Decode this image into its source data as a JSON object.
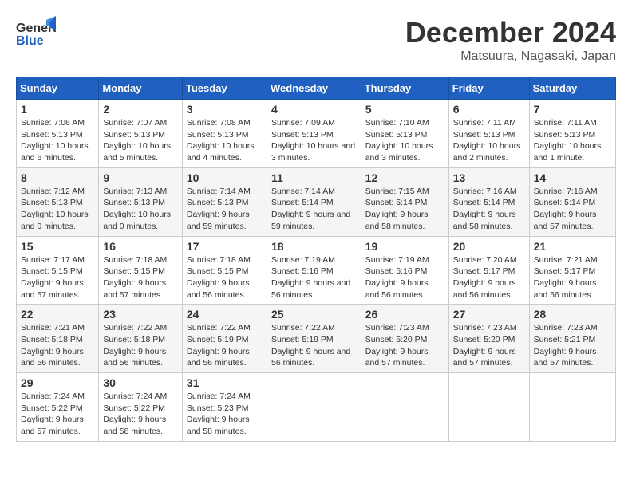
{
  "header": {
    "logo_line1": "General",
    "logo_line2": "Blue",
    "month": "December 2024",
    "location": "Matsuura, Nagasaki, Japan"
  },
  "weekdays": [
    "Sunday",
    "Monday",
    "Tuesday",
    "Wednesday",
    "Thursday",
    "Friday",
    "Saturday"
  ],
  "weeks": [
    [
      {
        "day": 1,
        "sunrise": "7:06 AM",
        "sunset": "5:13 PM",
        "daylight": "10 hours and 6 minutes."
      },
      {
        "day": 2,
        "sunrise": "7:07 AM",
        "sunset": "5:13 PM",
        "daylight": "10 hours and 5 minutes."
      },
      {
        "day": 3,
        "sunrise": "7:08 AM",
        "sunset": "5:13 PM",
        "daylight": "10 hours and 4 minutes."
      },
      {
        "day": 4,
        "sunrise": "7:09 AM",
        "sunset": "5:13 PM",
        "daylight": "10 hours and 3 minutes."
      },
      {
        "day": 5,
        "sunrise": "7:10 AM",
        "sunset": "5:13 PM",
        "daylight": "10 hours and 3 minutes."
      },
      {
        "day": 6,
        "sunrise": "7:11 AM",
        "sunset": "5:13 PM",
        "daylight": "10 hours and 2 minutes."
      },
      {
        "day": 7,
        "sunrise": "7:11 AM",
        "sunset": "5:13 PM",
        "daylight": "10 hours and 1 minute."
      }
    ],
    [
      {
        "day": 8,
        "sunrise": "7:12 AM",
        "sunset": "5:13 PM",
        "daylight": "10 hours and 0 minutes."
      },
      {
        "day": 9,
        "sunrise": "7:13 AM",
        "sunset": "5:13 PM",
        "daylight": "10 hours and 0 minutes."
      },
      {
        "day": 10,
        "sunrise": "7:14 AM",
        "sunset": "5:13 PM",
        "daylight": "9 hours and 59 minutes."
      },
      {
        "day": 11,
        "sunrise": "7:14 AM",
        "sunset": "5:14 PM",
        "daylight": "9 hours and 59 minutes."
      },
      {
        "day": 12,
        "sunrise": "7:15 AM",
        "sunset": "5:14 PM",
        "daylight": "9 hours and 58 minutes."
      },
      {
        "day": 13,
        "sunrise": "7:16 AM",
        "sunset": "5:14 PM",
        "daylight": "9 hours and 58 minutes."
      },
      {
        "day": 14,
        "sunrise": "7:16 AM",
        "sunset": "5:14 PM",
        "daylight": "9 hours and 57 minutes."
      }
    ],
    [
      {
        "day": 15,
        "sunrise": "7:17 AM",
        "sunset": "5:15 PM",
        "daylight": "9 hours and 57 minutes."
      },
      {
        "day": 16,
        "sunrise": "7:18 AM",
        "sunset": "5:15 PM",
        "daylight": "9 hours and 57 minutes."
      },
      {
        "day": 17,
        "sunrise": "7:18 AM",
        "sunset": "5:15 PM",
        "daylight": "9 hours and 56 minutes."
      },
      {
        "day": 18,
        "sunrise": "7:19 AM",
        "sunset": "5:16 PM",
        "daylight": "9 hours and 56 minutes."
      },
      {
        "day": 19,
        "sunrise": "7:19 AM",
        "sunset": "5:16 PM",
        "daylight": "9 hours and 56 minutes."
      },
      {
        "day": 20,
        "sunrise": "7:20 AM",
        "sunset": "5:17 PM",
        "daylight": "9 hours and 56 minutes."
      },
      {
        "day": 21,
        "sunrise": "7:21 AM",
        "sunset": "5:17 PM",
        "daylight": "9 hours and 56 minutes."
      }
    ],
    [
      {
        "day": 22,
        "sunrise": "7:21 AM",
        "sunset": "5:18 PM",
        "daylight": "9 hours and 56 minutes."
      },
      {
        "day": 23,
        "sunrise": "7:22 AM",
        "sunset": "5:18 PM",
        "daylight": "9 hours and 56 minutes."
      },
      {
        "day": 24,
        "sunrise": "7:22 AM",
        "sunset": "5:19 PM",
        "daylight": "9 hours and 56 minutes."
      },
      {
        "day": 25,
        "sunrise": "7:22 AM",
        "sunset": "5:19 PM",
        "daylight": "9 hours and 56 minutes."
      },
      {
        "day": 26,
        "sunrise": "7:23 AM",
        "sunset": "5:20 PM",
        "daylight": "9 hours and 57 minutes."
      },
      {
        "day": 27,
        "sunrise": "7:23 AM",
        "sunset": "5:20 PM",
        "daylight": "9 hours and 57 minutes."
      },
      {
        "day": 28,
        "sunrise": "7:23 AM",
        "sunset": "5:21 PM",
        "daylight": "9 hours and 57 minutes."
      }
    ],
    [
      {
        "day": 29,
        "sunrise": "7:24 AM",
        "sunset": "5:22 PM",
        "daylight": "9 hours and 57 minutes."
      },
      {
        "day": 30,
        "sunrise": "7:24 AM",
        "sunset": "5:22 PM",
        "daylight": "9 hours and 58 minutes."
      },
      {
        "day": 31,
        "sunrise": "7:24 AM",
        "sunset": "5:23 PM",
        "daylight": "9 hours and 58 minutes."
      },
      null,
      null,
      null,
      null
    ]
  ],
  "labels": {
    "sunrise": "Sunrise:",
    "sunset": "Sunset:",
    "daylight": "Daylight:"
  }
}
